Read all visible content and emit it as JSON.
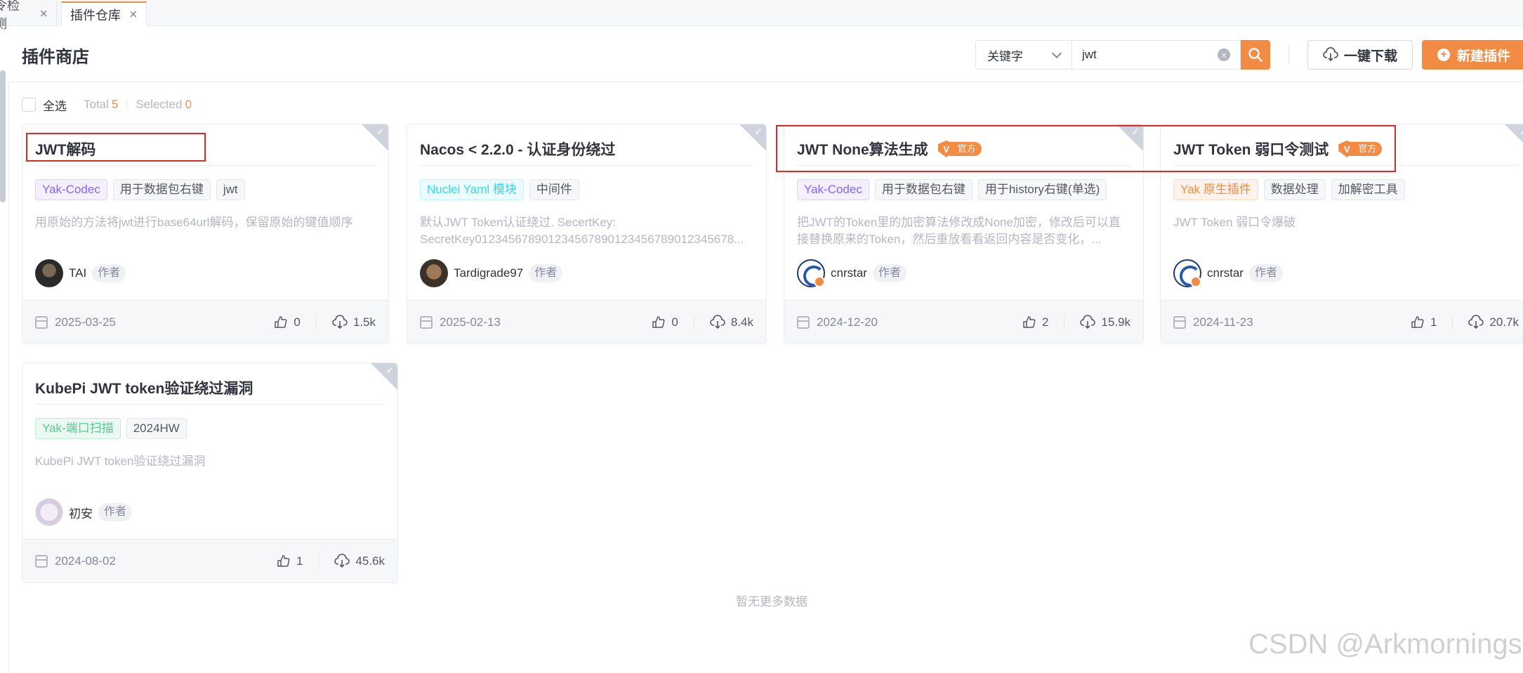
{
  "tabs": [
    {
      "label": "令检测",
      "close": "×"
    },
    {
      "label": "插件仓库",
      "close": "×"
    }
  ],
  "header": {
    "title": "插件商店",
    "search_type": "关键字",
    "search_value": "jwt",
    "download_label": "一键下载",
    "new_label": "新建插件"
  },
  "selection": {
    "select_all": "全选",
    "total_label": "Total",
    "total": "5",
    "selected_label": "Selected",
    "selected": "0"
  },
  "cards": [
    {
      "title": "JWT解码",
      "official": false,
      "tags": [
        {
          "text": "Yak-Codec",
          "color": "purple"
        },
        {
          "text": "用于数据包右键",
          "color": "gray"
        },
        {
          "text": "jwt",
          "color": "gray"
        }
      ],
      "desc": "用原始的方法将jwt进行base64url解码，保留原始的键值顺序",
      "author": "TAI",
      "role": "作者",
      "date": "2025-03-25",
      "likes": "0",
      "downloads": "1.5k"
    },
    {
      "title": "Nacos < 2.2.0 - 认证身份绕过",
      "official": false,
      "tags": [
        {
          "text": "Nuclei Yaml 模块",
          "color": "cyan"
        },
        {
          "text": "中间件",
          "color": "gray"
        }
      ],
      "desc": "默认JWT Token认证绕过. SecertKey: SecretKey012345678901234567890123456789012345678...",
      "author": "Tardigrade97",
      "role": "作者",
      "date": "2025-02-13",
      "likes": "0",
      "downloads": "8.4k"
    },
    {
      "title": "JWT None算法生成",
      "official": true,
      "official_label": "官方",
      "tags": [
        {
          "text": "Yak-Codec",
          "color": "purple"
        },
        {
          "text": "用于数据包右键",
          "color": "gray"
        },
        {
          "text": "用于history右键(单选)",
          "color": "gray"
        }
      ],
      "desc": "把JWT的Token里的加密算法修改成None加密，修改后可以直接替换原来的Token，然后重放看看返回内容是否变化，...",
      "author": "cnrstar",
      "role": "作者",
      "date": "2024-12-20",
      "likes": "2",
      "downloads": "15.9k"
    },
    {
      "title": "JWT Token 弱口令测试",
      "official": true,
      "official_label": "官方",
      "tags": [
        {
          "text": "Yak 原生插件",
          "color": "orange"
        },
        {
          "text": "数据处理",
          "color": "gray"
        },
        {
          "text": "加解密工具",
          "color": "gray"
        }
      ],
      "desc": "JWT Token 弱口令爆破",
      "author": "cnrstar",
      "role": "作者",
      "date": "2024-11-23",
      "likes": "1",
      "downloads": "20.7k"
    },
    {
      "title": "KubePi JWT token验证绕过漏洞",
      "official": false,
      "tags": [
        {
          "text": "Yak-端口扫描",
          "color": "green"
        },
        {
          "text": "2024HW",
          "color": "gray"
        }
      ],
      "desc": "KubePi JWT token验证绕过漏洞",
      "author": "初安",
      "role": "作者",
      "date": "2024-08-02",
      "likes": "1",
      "downloads": "45.6k"
    }
  ],
  "no_more": "暂无更多数据",
  "watermark": "CSDN @Arkmornings",
  "colors": {
    "accent": "#f28b44",
    "annotation": "#e02828"
  }
}
